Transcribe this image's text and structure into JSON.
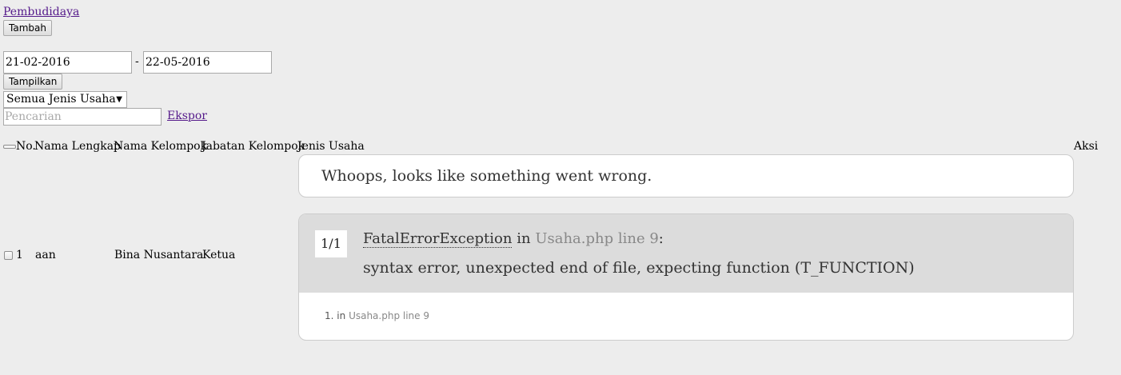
{
  "nav": {
    "link_label": "Pembudidaya"
  },
  "toolbar": {
    "add_label": "Tambah",
    "show_label": "Tampilkan",
    "export_label": "Ekspor"
  },
  "filter": {
    "date_from": "21-02-2016",
    "date_separator": "-",
    "date_to": "22-05-2016",
    "business_type_selected": "Semua Jenis Usaha",
    "search_placeholder": "Pencarian"
  },
  "table": {
    "headers": [
      "No.",
      "Nama Lengkap",
      "Nama Kelompok",
      "Jabatan Kelompok",
      "Jenis Usaha",
      "Aksi"
    ],
    "rows": [
      {
        "no": "1",
        "nama_lengkap": "aan",
        "nama_kelompok": "Bina Nusantara",
        "jabatan_kelompok": "Ketua"
      }
    ]
  },
  "error": {
    "title": "Whoops, looks like something went wrong.",
    "counter": "1/1",
    "exception_name": "FatalErrorException",
    "in_word": "in",
    "location": "Usaha.php line 9",
    "colon": ":",
    "message": "syntax error, unexpected end of file, expecting function (T_FUNCTION)",
    "trace": [
      {
        "index": "1.",
        "in_word": "in",
        "location": "Usaha.php line 9"
      }
    ]
  }
}
